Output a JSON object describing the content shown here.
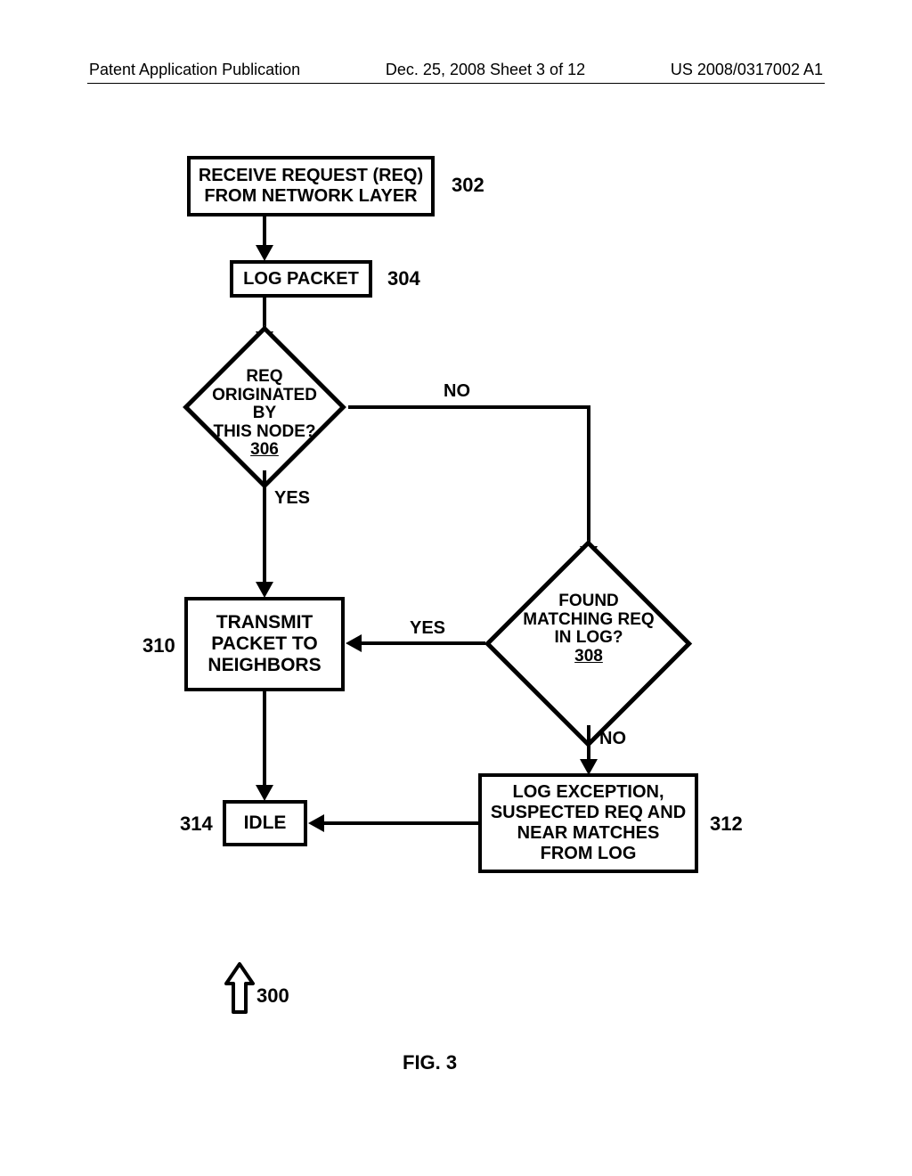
{
  "header": {
    "left": "Patent Application Publication",
    "center": "Dec. 25, 2008  Sheet 3 of 12",
    "right": "US 2008/0317002 A1"
  },
  "boxes": {
    "b302": {
      "line1": "RECEIVE REQUEST (REQ)",
      "line2": "FROM NETWORK LAYER",
      "ref": "302"
    },
    "b304": {
      "line1": "LOG PACKET",
      "ref": "304"
    },
    "b310": {
      "line1": "TRANSMIT",
      "line2": "PACKET TO",
      "line3": "NEIGHBORS",
      "ref": "310"
    },
    "b312": {
      "line1": "LOG EXCEPTION,",
      "line2": "SUSPECTED REQ AND",
      "line3": "NEAR MATCHES",
      "line4": "FROM LOG",
      "ref": "312"
    },
    "b314": {
      "line1": "IDLE",
      "ref": "314"
    }
  },
  "decisions": {
    "d306": {
      "line1": "REQ",
      "line2": "ORIGINATED BY",
      "line3": "THIS NODE?",
      "ref": "306"
    },
    "d308": {
      "line1": "FOUND",
      "line2": "MATCHING REQ",
      "line3": "IN LOG?",
      "ref": "308"
    }
  },
  "edgelabels": {
    "yes306": "YES",
    "no306": "NO",
    "yes308": "YES",
    "no308": "NO"
  },
  "figure": {
    "ref": "300",
    "caption": "FIG. 3"
  }
}
